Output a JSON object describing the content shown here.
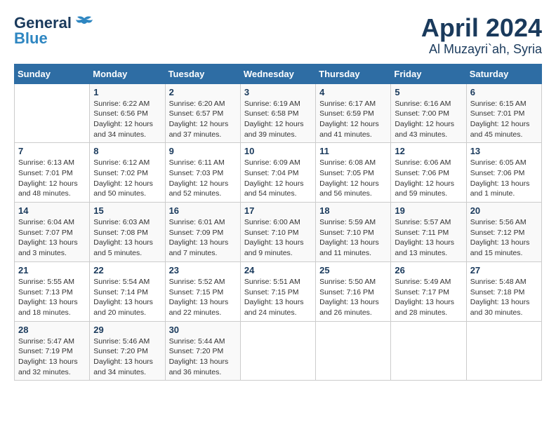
{
  "header": {
    "logo_line1": "General",
    "logo_line2": "Blue",
    "title": "April 2024",
    "subtitle": "Al Muzayri`ah, Syria"
  },
  "days_of_week": [
    "Sunday",
    "Monday",
    "Tuesday",
    "Wednesday",
    "Thursday",
    "Friday",
    "Saturday"
  ],
  "weeks": [
    [
      {
        "num": "",
        "info": ""
      },
      {
        "num": "1",
        "info": "Sunrise: 6:22 AM\nSunset: 6:56 PM\nDaylight: 12 hours\nand 34 minutes."
      },
      {
        "num": "2",
        "info": "Sunrise: 6:20 AM\nSunset: 6:57 PM\nDaylight: 12 hours\nand 37 minutes."
      },
      {
        "num": "3",
        "info": "Sunrise: 6:19 AM\nSunset: 6:58 PM\nDaylight: 12 hours\nand 39 minutes."
      },
      {
        "num": "4",
        "info": "Sunrise: 6:17 AM\nSunset: 6:59 PM\nDaylight: 12 hours\nand 41 minutes."
      },
      {
        "num": "5",
        "info": "Sunrise: 6:16 AM\nSunset: 7:00 PM\nDaylight: 12 hours\nand 43 minutes."
      },
      {
        "num": "6",
        "info": "Sunrise: 6:15 AM\nSunset: 7:01 PM\nDaylight: 12 hours\nand 45 minutes."
      }
    ],
    [
      {
        "num": "7",
        "info": "Sunrise: 6:13 AM\nSunset: 7:01 PM\nDaylight: 12 hours\nand 48 minutes."
      },
      {
        "num": "8",
        "info": "Sunrise: 6:12 AM\nSunset: 7:02 PM\nDaylight: 12 hours\nand 50 minutes."
      },
      {
        "num": "9",
        "info": "Sunrise: 6:11 AM\nSunset: 7:03 PM\nDaylight: 12 hours\nand 52 minutes."
      },
      {
        "num": "10",
        "info": "Sunrise: 6:09 AM\nSunset: 7:04 PM\nDaylight: 12 hours\nand 54 minutes."
      },
      {
        "num": "11",
        "info": "Sunrise: 6:08 AM\nSunset: 7:05 PM\nDaylight: 12 hours\nand 56 minutes."
      },
      {
        "num": "12",
        "info": "Sunrise: 6:06 AM\nSunset: 7:06 PM\nDaylight: 12 hours\nand 59 minutes."
      },
      {
        "num": "13",
        "info": "Sunrise: 6:05 AM\nSunset: 7:06 PM\nDaylight: 13 hours\nand 1 minute."
      }
    ],
    [
      {
        "num": "14",
        "info": "Sunrise: 6:04 AM\nSunset: 7:07 PM\nDaylight: 13 hours\nand 3 minutes."
      },
      {
        "num": "15",
        "info": "Sunrise: 6:03 AM\nSunset: 7:08 PM\nDaylight: 13 hours\nand 5 minutes."
      },
      {
        "num": "16",
        "info": "Sunrise: 6:01 AM\nSunset: 7:09 PM\nDaylight: 13 hours\nand 7 minutes."
      },
      {
        "num": "17",
        "info": "Sunrise: 6:00 AM\nSunset: 7:10 PM\nDaylight: 13 hours\nand 9 minutes."
      },
      {
        "num": "18",
        "info": "Sunrise: 5:59 AM\nSunset: 7:10 PM\nDaylight: 13 hours\nand 11 minutes."
      },
      {
        "num": "19",
        "info": "Sunrise: 5:57 AM\nSunset: 7:11 PM\nDaylight: 13 hours\nand 13 minutes."
      },
      {
        "num": "20",
        "info": "Sunrise: 5:56 AM\nSunset: 7:12 PM\nDaylight: 13 hours\nand 15 minutes."
      }
    ],
    [
      {
        "num": "21",
        "info": "Sunrise: 5:55 AM\nSunset: 7:13 PM\nDaylight: 13 hours\nand 18 minutes."
      },
      {
        "num": "22",
        "info": "Sunrise: 5:54 AM\nSunset: 7:14 PM\nDaylight: 13 hours\nand 20 minutes."
      },
      {
        "num": "23",
        "info": "Sunrise: 5:52 AM\nSunset: 7:15 PM\nDaylight: 13 hours\nand 22 minutes."
      },
      {
        "num": "24",
        "info": "Sunrise: 5:51 AM\nSunset: 7:15 PM\nDaylight: 13 hours\nand 24 minutes."
      },
      {
        "num": "25",
        "info": "Sunrise: 5:50 AM\nSunset: 7:16 PM\nDaylight: 13 hours\nand 26 minutes."
      },
      {
        "num": "26",
        "info": "Sunrise: 5:49 AM\nSunset: 7:17 PM\nDaylight: 13 hours\nand 28 minutes."
      },
      {
        "num": "27",
        "info": "Sunrise: 5:48 AM\nSunset: 7:18 PM\nDaylight: 13 hours\nand 30 minutes."
      }
    ],
    [
      {
        "num": "28",
        "info": "Sunrise: 5:47 AM\nSunset: 7:19 PM\nDaylight: 13 hours\nand 32 minutes."
      },
      {
        "num": "29",
        "info": "Sunrise: 5:46 AM\nSunset: 7:20 PM\nDaylight: 13 hours\nand 34 minutes."
      },
      {
        "num": "30",
        "info": "Sunrise: 5:44 AM\nSunset: 7:20 PM\nDaylight: 13 hours\nand 36 minutes."
      },
      {
        "num": "",
        "info": ""
      },
      {
        "num": "",
        "info": ""
      },
      {
        "num": "",
        "info": ""
      },
      {
        "num": "",
        "info": ""
      }
    ]
  ]
}
